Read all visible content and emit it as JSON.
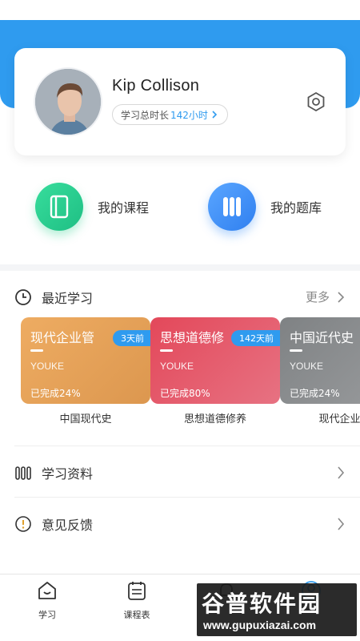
{
  "profile": {
    "name": "Kip Collison",
    "study_label": "学习总时长",
    "study_hours": "142小时"
  },
  "quick_actions": [
    {
      "label": "我的课程",
      "icon": "book-icon",
      "color": "#2ed08f"
    },
    {
      "label": "我的题库",
      "icon": "question-bank-icon",
      "color": "#3a8ef5"
    }
  ],
  "recent": {
    "title": "最近学习",
    "more": "更多",
    "courses": [
      {
        "cover_title": "现代企业管",
        "badge": "3天前",
        "brand": "YOUKE",
        "progress": "已完成24%",
        "name": "中国现代史",
        "color": "#e7a35a"
      },
      {
        "cover_title": "思想道德修",
        "badge": "142天前",
        "brand": "YOUKE",
        "progress": "已完成80%",
        "name": "思想道德修养",
        "color": "#e25b6a"
      },
      {
        "cover_title": "中国近代史",
        "badge": "",
        "brand": "YOUKE",
        "progress": "已完成24%",
        "name": "现代企业管",
        "color": "#8a8d8f"
      }
    ]
  },
  "menu": [
    {
      "label": "学习资料",
      "icon": "books-icon"
    },
    {
      "label": "意见反馈",
      "icon": "feedback-icon"
    }
  ],
  "tabbar": [
    {
      "label": "学习",
      "icon": "home-icon"
    },
    {
      "label": "课程表",
      "icon": "calendar-icon"
    },
    {
      "label": "",
      "icon": "bell-icon"
    },
    {
      "label": "",
      "icon": "user-icon"
    }
  ],
  "watermark": {
    "line1": "谷普软件园",
    "line2": "www.gupuxiazai.com"
  },
  "colors": {
    "accent": "#2f9bef",
    "header_blue": "#2f9bef"
  }
}
